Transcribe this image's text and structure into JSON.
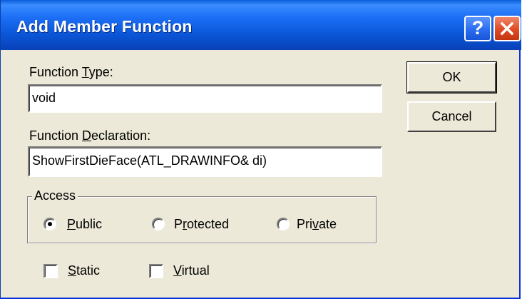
{
  "dialog": {
    "title": "Add Member Function",
    "help_glyph": "?",
    "help_icon": "help-icon",
    "close_icon": "close-icon"
  },
  "function_type": {
    "label_prefix": "Function ",
    "label_mnemonic": "T",
    "label_suffix": "ype:",
    "value": "void"
  },
  "function_declaration": {
    "label_prefix": "Function ",
    "label_mnemonic": "D",
    "label_suffix": "eclaration:",
    "value": "ShowFirstDieFace(ATL_DRAWINFO& di)"
  },
  "buttons": {
    "ok_label": "OK",
    "cancel_label": "Cancel"
  },
  "access": {
    "legend": "Access",
    "public": {
      "mnemonic": "P",
      "rest": "ublic",
      "selected": true
    },
    "protected": {
      "prefix": "P",
      "mnemonic": "r",
      "rest": "otected",
      "selected": false
    },
    "private": {
      "prefix": "Pri",
      "mnemonic": "v",
      "rest": "ate",
      "selected": false
    }
  },
  "modifiers": {
    "static": {
      "mnemonic": "S",
      "rest": "tatic",
      "checked": false
    },
    "virtual": {
      "mnemonic": "V",
      "rest": "irtual",
      "checked": false
    }
  },
  "colors": {
    "titlebar": "#0a55d6",
    "dialog_bg": "#ece9d8",
    "close_button": "#e04a23"
  }
}
